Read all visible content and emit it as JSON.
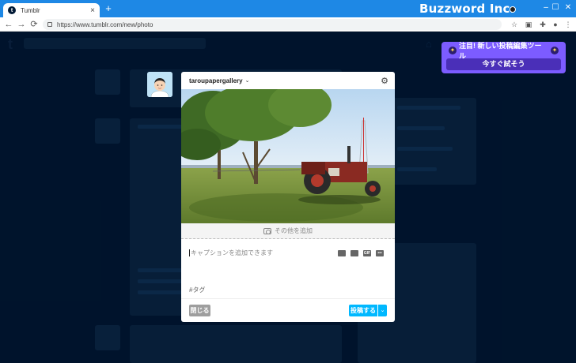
{
  "browser": {
    "tab_title": "Tumblr",
    "tab_favicon": "t",
    "close_icon": "×",
    "new_tab_icon": "+",
    "url": "https://www.tumblr.com/new/photo",
    "brand_overlay": "Buzzword Inc.",
    "window_controls": [
      "–",
      "☐",
      "✕"
    ],
    "nav": {
      "back": "←",
      "forward": "→",
      "reload": "⟳"
    }
  },
  "tumblr": {
    "logo": "t"
  },
  "promo": {
    "title": "注目! 新しい投稿編集ツール",
    "button": "今すぐ試そう",
    "sparkle": "✦",
    "color": "#7c5cff"
  },
  "composer": {
    "blog_name": "taroupapergallery",
    "chevron": "⌄",
    "settings_icon": "⚙",
    "add_more_label": "その他を追加",
    "caption_placeholder": "キャプションを追加できます",
    "tags_placeholder": "#タグ",
    "close_label": "閉じる",
    "post_label": "投稿する",
    "post_menu_icon": "⌄",
    "tools": [
      "link-icon",
      "video-icon",
      "gif-icon",
      "more-icon"
    ],
    "gif_label": "GIF",
    "more_label": "•••",
    "accent": "#00b8ff"
  }
}
